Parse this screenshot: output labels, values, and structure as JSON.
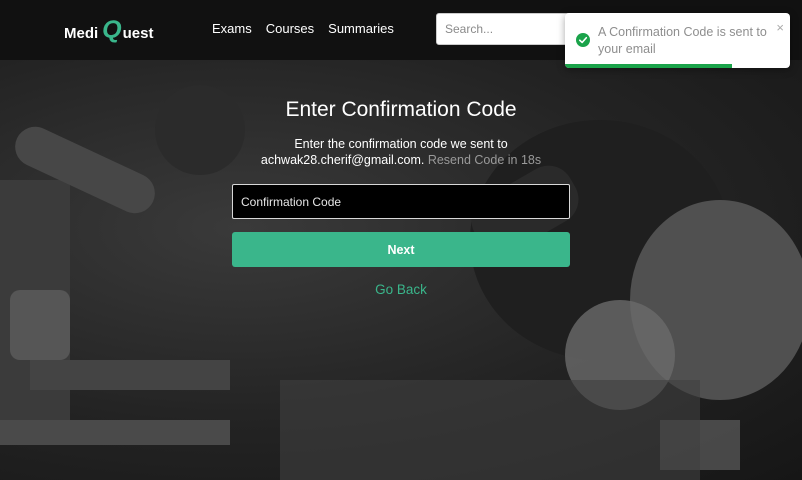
{
  "brand": {
    "part1": "Medi",
    "q": "Q",
    "part2": "uest",
    "accent": "#3ab68b"
  },
  "nav": {
    "links": [
      "Exams",
      "Courses",
      "Summaries"
    ]
  },
  "search": {
    "placeholder": "Search..."
  },
  "toast": {
    "message": "A Confirmation Code is sent to your email",
    "close": "×",
    "type": "success",
    "progress": 0.74
  },
  "form": {
    "title": "Enter Confirmation Code",
    "line1": "Enter the confirmation code we sent to",
    "email": "achwak28.cherif@gmail.com.",
    "resend": "Resend Code in 18s",
    "input_placeholder": "Confirmation Code",
    "next_label": "Next",
    "back_label": "Go Back"
  }
}
